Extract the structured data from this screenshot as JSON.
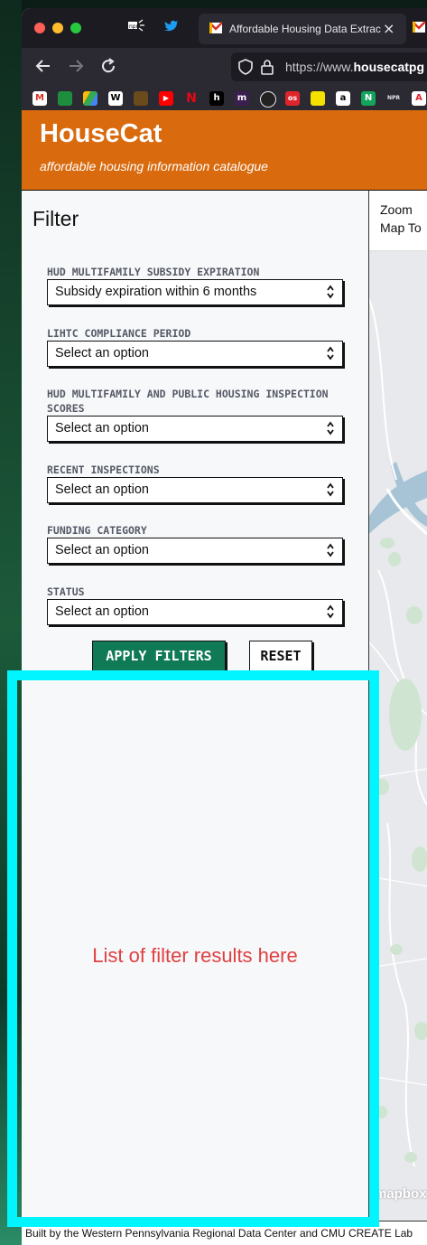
{
  "browser": {
    "tab_title": "Affordable Housing Data Extrac",
    "tab_close": "×",
    "url_prefix": "https://www.",
    "url_host": "housecatpg",
    "bookmarks": [
      "M",
      "",
      "",
      "W",
      "",
      "▶",
      "N",
      "h",
      "m",
      "",
      "os",
      "",
      "a",
      "N",
      "NPR",
      "A"
    ]
  },
  "site": {
    "title": "HouseCat",
    "subtitle": "affordable housing information catalogue"
  },
  "filter": {
    "title": "Filter",
    "fields": [
      {
        "label": "HUD MULTIFAMILY SUBSIDY EXPIRATION",
        "value": "Subsidy expiration within 6 months"
      },
      {
        "label": "LIHTC COMPLIANCE PERIOD",
        "value": "Select an option"
      },
      {
        "label": "HUD MULTIFAMILY AND PUBLIC HOUSING INSPECTION SCORES",
        "value": "Select an option"
      },
      {
        "label": "RECENT INSPECTIONS",
        "value": "Select an option"
      },
      {
        "label": "FUNDING CATEGORY",
        "value": "Select an option"
      },
      {
        "label": "STATUS",
        "value": "Select an option"
      }
    ],
    "apply_label": "APPLY FILTERS",
    "reset_label": "RESET"
  },
  "map": {
    "zoom_line1": "Zoom",
    "zoom_line2": "Map To",
    "logo": "mapbox"
  },
  "results": {
    "placeholder": "List of filter results here"
  },
  "footer": {
    "text": "Built by the Western Pennsylvania Regional Data Center and CMU CREATE Lab"
  },
  "colors": {
    "header": "#d96a0e",
    "apply": "#0f7a55",
    "highlight": "#00f5ff",
    "results_text": "#e04040"
  }
}
